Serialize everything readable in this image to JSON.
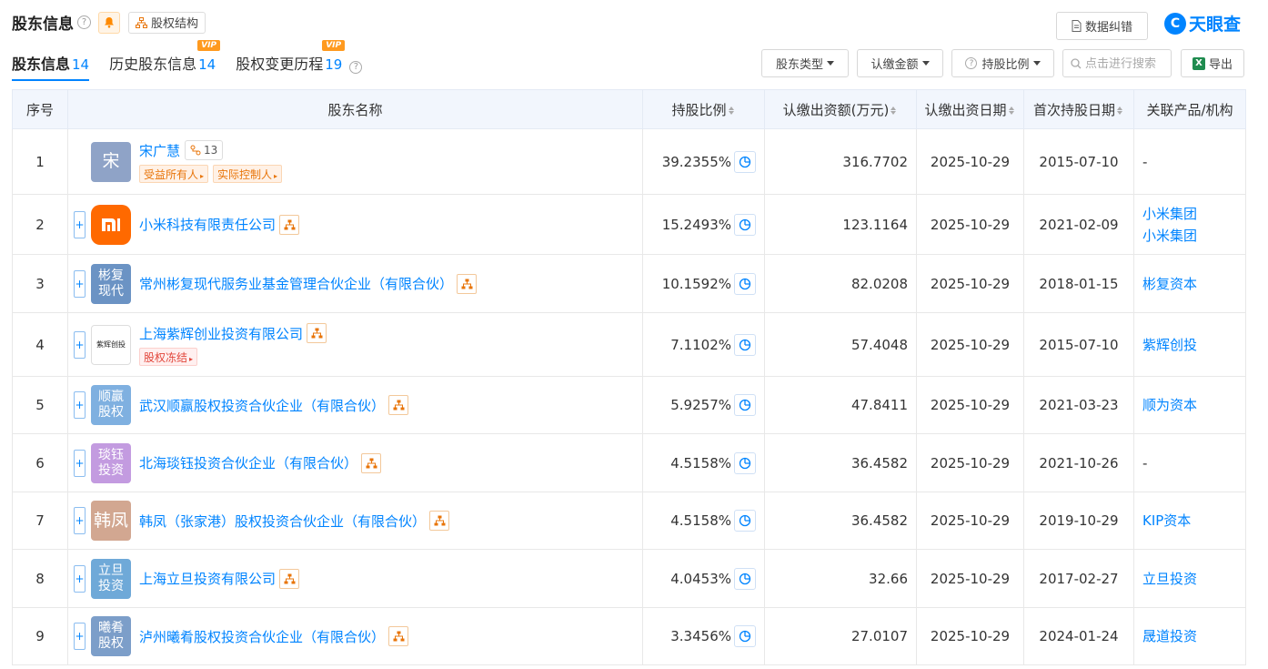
{
  "header": {
    "title": "股东信息",
    "help": "?",
    "struct_label": "股权结构",
    "report_label": "数据纠错",
    "logo_text": "天眼查",
    "logo_char": "C"
  },
  "tabs": [
    {
      "label": "股东信息",
      "count": "14",
      "vip": ""
    },
    {
      "label": "历史股东信息",
      "count": "14",
      "vip": "VIP"
    },
    {
      "label": "股权变更历程",
      "count": "19",
      "vip": "VIP"
    }
  ],
  "filters": {
    "type": "股东类型",
    "amount": "认缴金额",
    "ratio": "持股比例",
    "search_placeholder": "点击进行搜索",
    "export": "导出",
    "xls_letter": "X"
  },
  "columns": [
    "序号",
    "股东名称",
    "持股比例",
    "认缴出资额(万元)",
    "认缴出资日期",
    "首次持股日期",
    "关联产品/机构"
  ],
  "rows": [
    {
      "idx": "1",
      "name": "宋广慧",
      "avatar": "宋",
      "avatar_color": "#8fa3c7",
      "pct": "39.2355%",
      "amount": "316.7702",
      "sub_date": "2025-10-29",
      "first_date": "2015-07-10",
      "related": [
        "-"
      ],
      "tags": [
        "受益所有人",
        "实际控制人"
      ],
      "count": "13",
      "expand": false
    },
    {
      "idx": "2",
      "name": "小米科技有限责任公司",
      "avatar": "mi",
      "avatar_color": "#ff6900",
      "pct": "15.2493%",
      "amount": "123.1164",
      "sub_date": "2025-10-29",
      "first_date": "2021-02-09",
      "related": [
        "小米集团",
        "小米集团"
      ],
      "tags": [],
      "expand": true
    },
    {
      "idx": "3",
      "name": "常州彬复现代服务业基金管理合伙企业（有限合伙）",
      "avatar": "彬复\n现代",
      "avatar_color": "#6b93c4",
      "pct": "10.1592%",
      "amount": "82.0208",
      "sub_date": "2025-10-29",
      "first_date": "2018-01-15",
      "related": [
        "彬复资本"
      ],
      "tags": [],
      "expand": true
    },
    {
      "idx": "4",
      "name": "上海紫辉创业投资有限公司",
      "avatar": "紫辉创投",
      "avatar_color": "#ffffff",
      "pct": "7.1102%",
      "amount": "57.4048",
      "sub_date": "2025-10-29",
      "first_date": "2015-07-10",
      "related": [
        "紫辉创投"
      ],
      "tags": [
        "股权冻结"
      ],
      "expand": true
    },
    {
      "idx": "5",
      "name": "武汉顺赢股权投资合伙企业（有限合伙）",
      "avatar": "顺赢\n股权",
      "avatar_color": "#7fb0e0",
      "pct": "5.9257%",
      "amount": "47.8411",
      "sub_date": "2025-10-29",
      "first_date": "2021-03-23",
      "related": [
        "顺为资本"
      ],
      "tags": [],
      "expand": true
    },
    {
      "idx": "6",
      "name": "北海琰钰投资合伙企业（有限合伙）",
      "avatar": "琰钰\n投资",
      "avatar_color": "#c39be0",
      "pct": "4.5158%",
      "amount": "36.4582",
      "sub_date": "2025-10-29",
      "first_date": "2021-10-26",
      "related": [
        "-"
      ],
      "tags": [],
      "expand": true
    },
    {
      "idx": "7",
      "name": "韩凤（张家港）股权投资合伙企业（有限合伙）",
      "avatar": "韩凤",
      "avatar_color": "#d2a791",
      "pct": "4.5158%",
      "amount": "36.4582",
      "sub_date": "2025-10-29",
      "first_date": "2019-10-29",
      "related": [
        "KIP资本"
      ],
      "tags": [],
      "expand": true
    },
    {
      "idx": "8",
      "name": "上海立旦投资有限公司",
      "avatar": "立旦\n投资",
      "avatar_color": "#6fa9d8",
      "pct": "4.0453%",
      "amount": "32.66",
      "sub_date": "2025-10-29",
      "first_date": "2017-02-27",
      "related": [
        "立旦投资"
      ],
      "tags": [],
      "expand": true
    },
    {
      "idx": "9",
      "name": "泸州曦肴股权投资合伙企业（有限合伙）",
      "avatar": "曦肴\n股权",
      "avatar_color": "#7c9ec9",
      "pct": "3.3456%",
      "amount": "27.0107",
      "sub_date": "2025-10-29",
      "first_date": "2024-01-24",
      "related": [
        "晟道投资"
      ],
      "tags": [],
      "expand": true
    }
  ]
}
